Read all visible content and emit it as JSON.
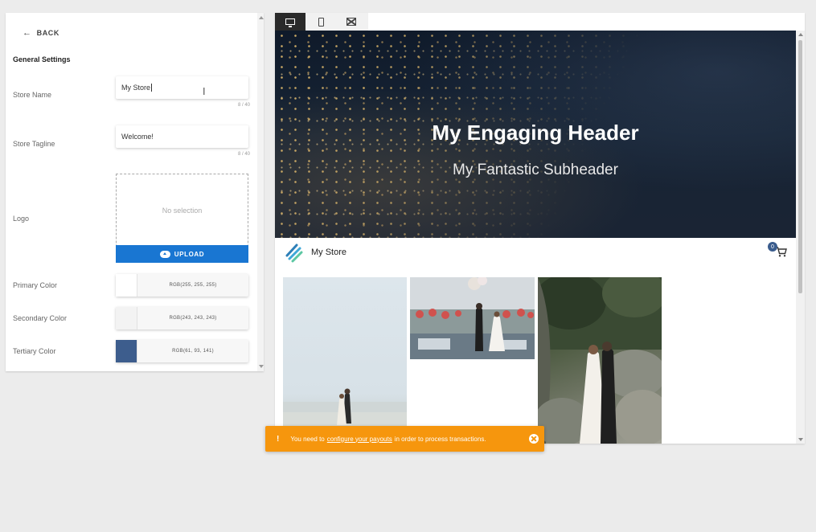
{
  "settings": {
    "back_label": "BACK",
    "section_title": "General Settings",
    "store_name": {
      "label": "Store Name",
      "value": "My Store",
      "counter": "8 / 40"
    },
    "store_tagline": {
      "label": "Store Tagline",
      "value": "Welcome!",
      "counter": "8 / 40"
    },
    "logo": {
      "label": "Logo",
      "placeholder": "No selection",
      "upload_label": "UPLOAD"
    },
    "colors": [
      {
        "label": "Primary Color",
        "value": "RGB(255, 255, 255)",
        "hex": "#ffffff"
      },
      {
        "label": "Secondary Color",
        "value": "RGB(243, 243, 243)",
        "hex": "#f3f3f3"
      },
      {
        "label": "Tertiary Color",
        "value": "RGB(61, 93, 141)",
        "hex": "#3d5d8d"
      }
    ]
  },
  "preview": {
    "devices": [
      "desktop-icon",
      "phone-icon",
      "fullscreen-icon"
    ],
    "active_device": "desktop",
    "header_title": "My Engaging Header",
    "header_subtitle": "My Fantastic Subheader",
    "store_name": "My Store",
    "cart_count": "0"
  },
  "toast": {
    "text_before": "You need to",
    "link_text": "configure your payouts",
    "text_after": "in order to process transactions."
  },
  "colors": {
    "upload_button": "#1976d2",
    "toast": "#f6960d",
    "active_device": "#2a2a2a"
  }
}
